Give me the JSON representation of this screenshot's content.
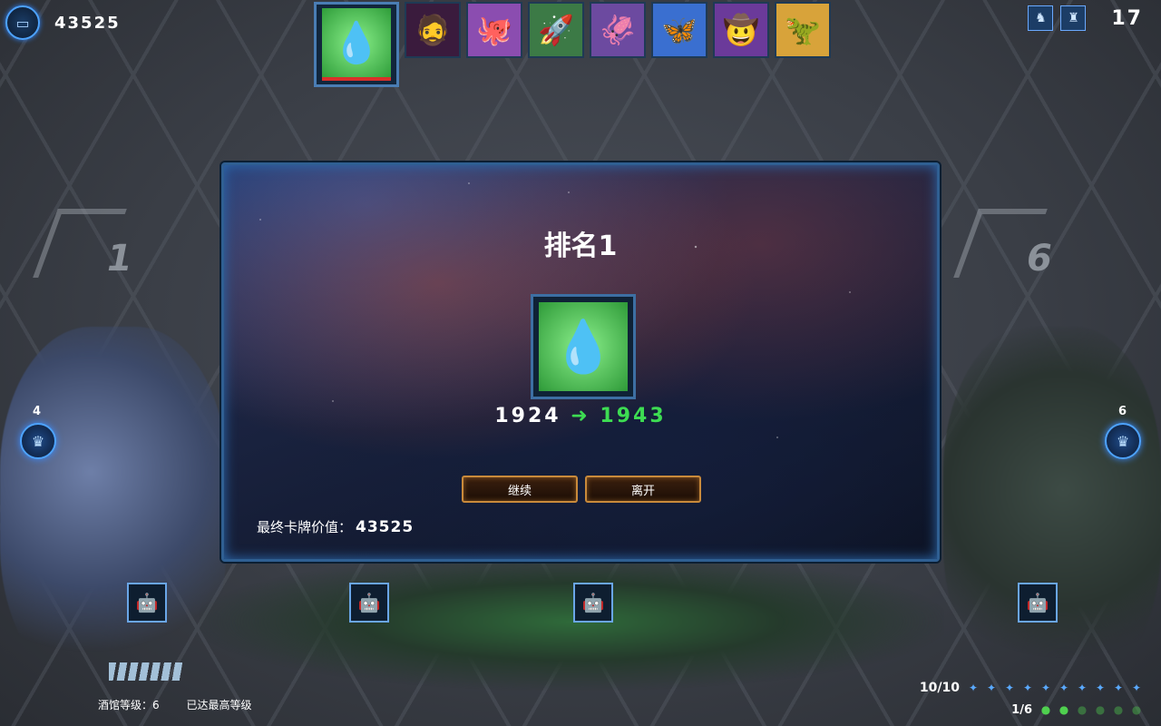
{
  "top_left": {
    "icon": "monitor-icon",
    "score": "43525"
  },
  "top_right": {
    "round": "17"
  },
  "players": [
    {
      "icon": "💧",
      "bg": "#5fd45f"
    },
    {
      "icon": "🧔",
      "bg": "#3a1b3d"
    },
    {
      "icon": "🐙",
      "bg": "#8b4db0"
    },
    {
      "icon": "🚀",
      "bg": "#3c7a46"
    },
    {
      "icon": "🦑",
      "bg": "#6c4aa0"
    },
    {
      "icon": "🦋",
      "bg": "#3a6fd0"
    },
    {
      "icon": "🤠",
      "bg": "#6b3a9a"
    },
    {
      "icon": "🦖",
      "bg": "#d8a33a"
    }
  ],
  "board": {
    "left_slot": "1",
    "right_slot": "6",
    "left_badge_count": "4",
    "right_badge_count": "6"
  },
  "modal": {
    "title": "排名1",
    "portrait_icon": "💧",
    "rating_old": "1924",
    "rating_arrow": "➜",
    "rating_new": "1943",
    "continue_label": "继续",
    "leave_label": "离开",
    "final_label": "最终卡牌价值：",
    "final_value": "43525"
  },
  "bottom": {
    "tavern_level_label": "酒馆等级：6",
    "max_level_label": "已达最高等级",
    "supply": "10/10",
    "upgrades": "1/6"
  }
}
